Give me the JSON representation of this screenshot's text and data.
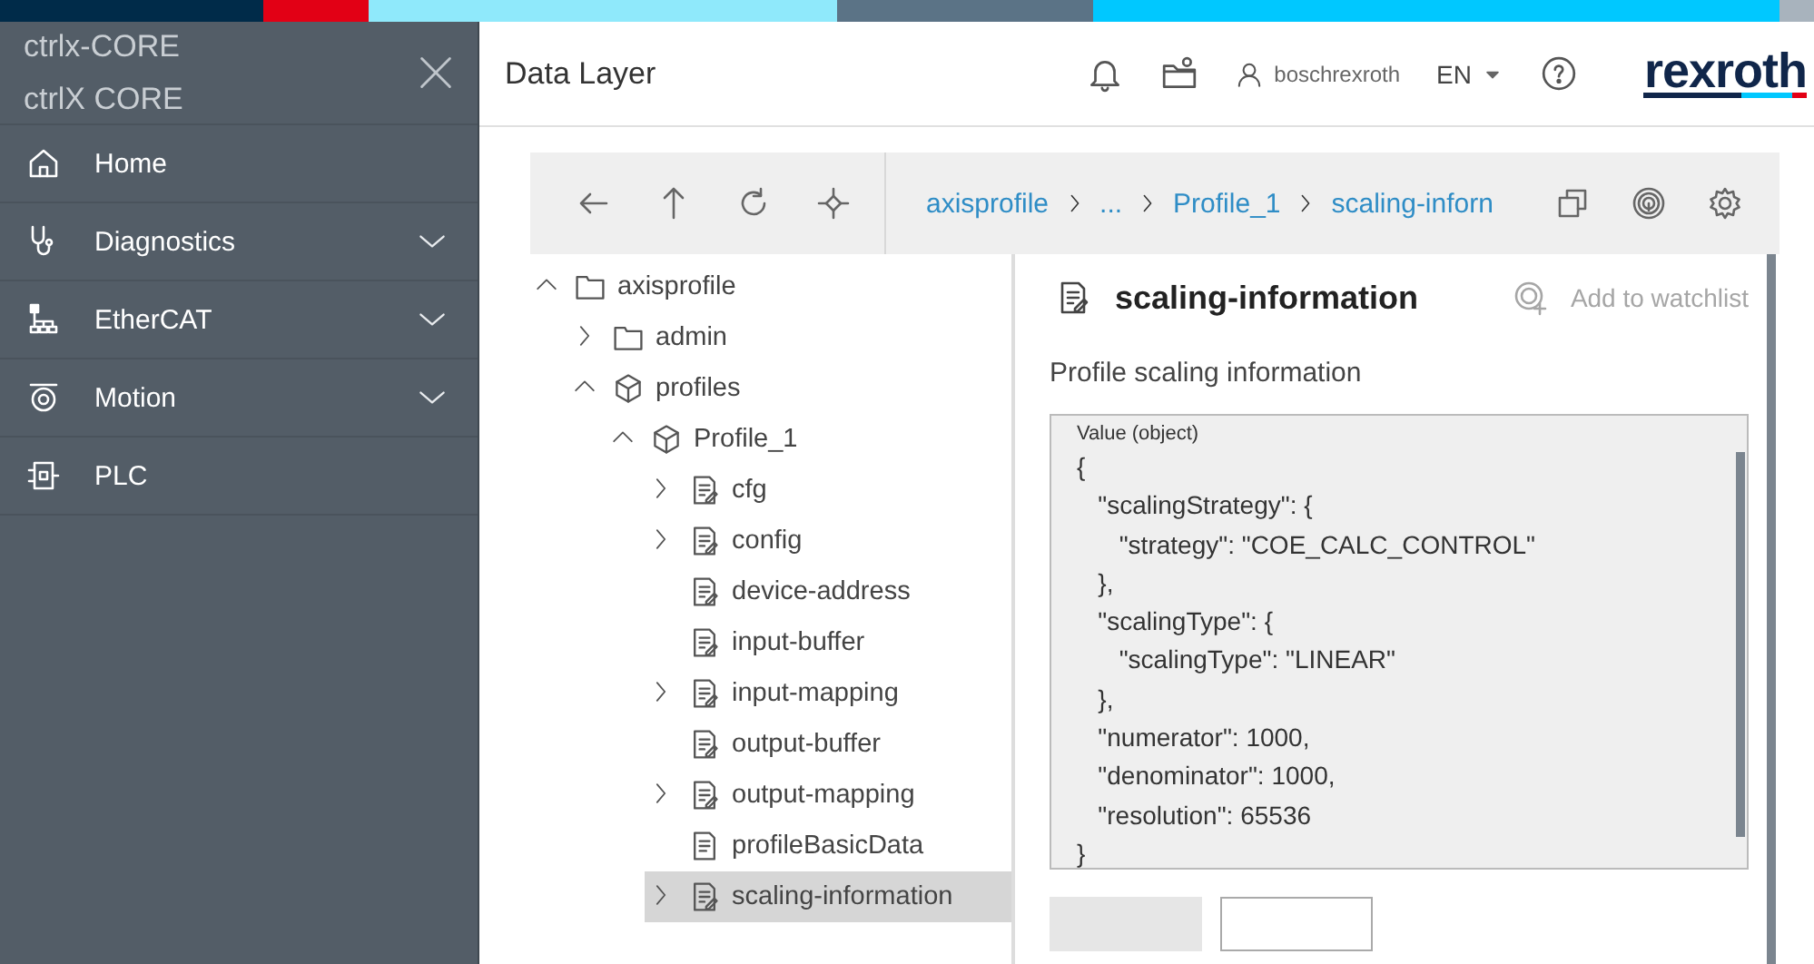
{
  "sidebar": {
    "titles": [
      "ctrlx-CORE",
      "ctrlX CORE"
    ],
    "items": [
      {
        "label": "Home",
        "expandable": false
      },
      {
        "label": "Diagnostics",
        "expandable": true
      },
      {
        "label": "EtherCAT",
        "expandable": true
      },
      {
        "label": "Motion",
        "expandable": true
      },
      {
        "label": "PLC",
        "expandable": false
      }
    ]
  },
  "header": {
    "title": "Data Layer",
    "user": "boschrexroth",
    "language": "EN",
    "logo": "rexroth"
  },
  "toolbar": {
    "breadcrumb": [
      "axisprofile",
      "...",
      "Profile_1",
      "scaling-inforn"
    ]
  },
  "tree": [
    {
      "label": "axisprofile",
      "kind": "folder",
      "expanded": true,
      "selected": false,
      "children": [
        {
          "label": "admin",
          "kind": "folder",
          "expanded": false,
          "selected": false
        },
        {
          "label": "profiles",
          "kind": "node",
          "expanded": true,
          "selected": false,
          "children": [
            {
              "label": "Profile_1",
              "kind": "node",
              "expanded": true,
              "selected": false,
              "children": [
                {
                  "label": "cfg",
                  "kind": "variable",
                  "expanded": false,
                  "selected": false
                },
                {
                  "label": "config",
                  "kind": "variable",
                  "expanded": false,
                  "selected": false
                },
                {
                  "label": "device-address",
                  "kind": "variable",
                  "selected": false
                },
                {
                  "label": "input-buffer",
                  "kind": "variable",
                  "selected": false
                },
                {
                  "label": "input-mapping",
                  "kind": "variable",
                  "expanded": false,
                  "selected": false
                },
                {
                  "label": "output-buffer",
                  "kind": "variable",
                  "selected": false
                },
                {
                  "label": "output-mapping",
                  "kind": "variable",
                  "expanded": false,
                  "selected": false
                },
                {
                  "label": "profileBasicData",
                  "kind": "document",
                  "selected": false
                },
                {
                  "label": "scaling-information",
                  "kind": "variable",
                  "expanded": false,
                  "selected": true
                }
              ]
            }
          ]
        }
      ]
    }
  ],
  "detail": {
    "title": "scaling-information",
    "watchlist": {
      "label": "Add to watchlist",
      "disabled": true
    },
    "description": "Profile scaling information",
    "value": {
      "label": "Value (object)",
      "lines": [
        "{",
        "   \"scalingStrategy\": {",
        "      \"strategy\": \"COE_CALC_CONTROL\"",
        "   },",
        "   \"scalingType\": {",
        "      \"scalingType\": \"LINEAR\"",
        "   },",
        "   \"numerator\": 1000,",
        "   \"denominator\": 1000,",
        "   \"resolution\": 65536",
        "}"
      ]
    },
    "buttons": [
      {
        "kind": "filled",
        "disabled": true
      },
      {
        "kind": "outlined",
        "disabled": false
      }
    ]
  }
}
